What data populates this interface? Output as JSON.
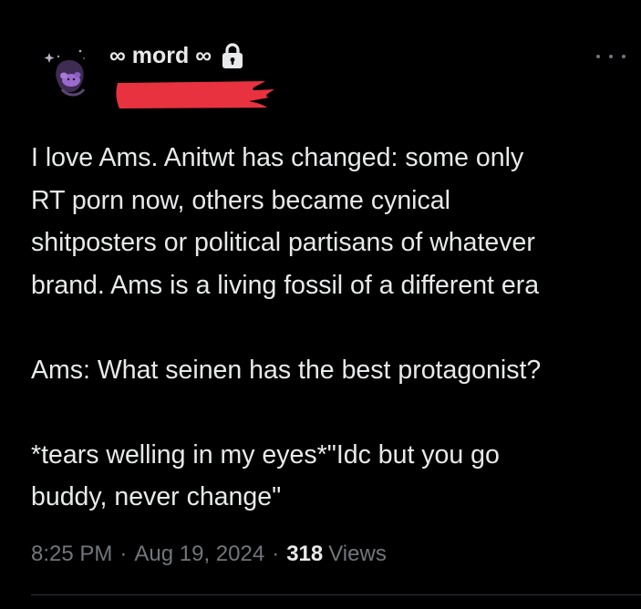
{
  "tweet": {
    "author": {
      "display_name": "∞ mord ∞",
      "verified_icon": "lock-icon",
      "handle_redacted": true,
      "redaction_color": "#e8323f"
    },
    "text_lines": [
      "I love Ams. Anitwt has changed: some only",
      "RT porn now, others became cynical",
      "shitposters or political partisans of whatever",
      "brand. Ams is a living fossil of a different era",
      "",
      "Ams: What seinen has the best protagonist?",
      "",
      "*tears welling in my eyes*\"Idc but you go",
      "buddy, never change\""
    ],
    "time": "8:25 PM",
    "date": "Aug 19, 2024",
    "separator": "·",
    "views_count": "318",
    "views_label": "Views",
    "more_icon": "more-options-icon"
  },
  "colors": {
    "background": "#000000",
    "text_primary": "#e7e9ea",
    "text_secondary": "#71767b",
    "accent_avatar": "#9a6ad0"
  }
}
